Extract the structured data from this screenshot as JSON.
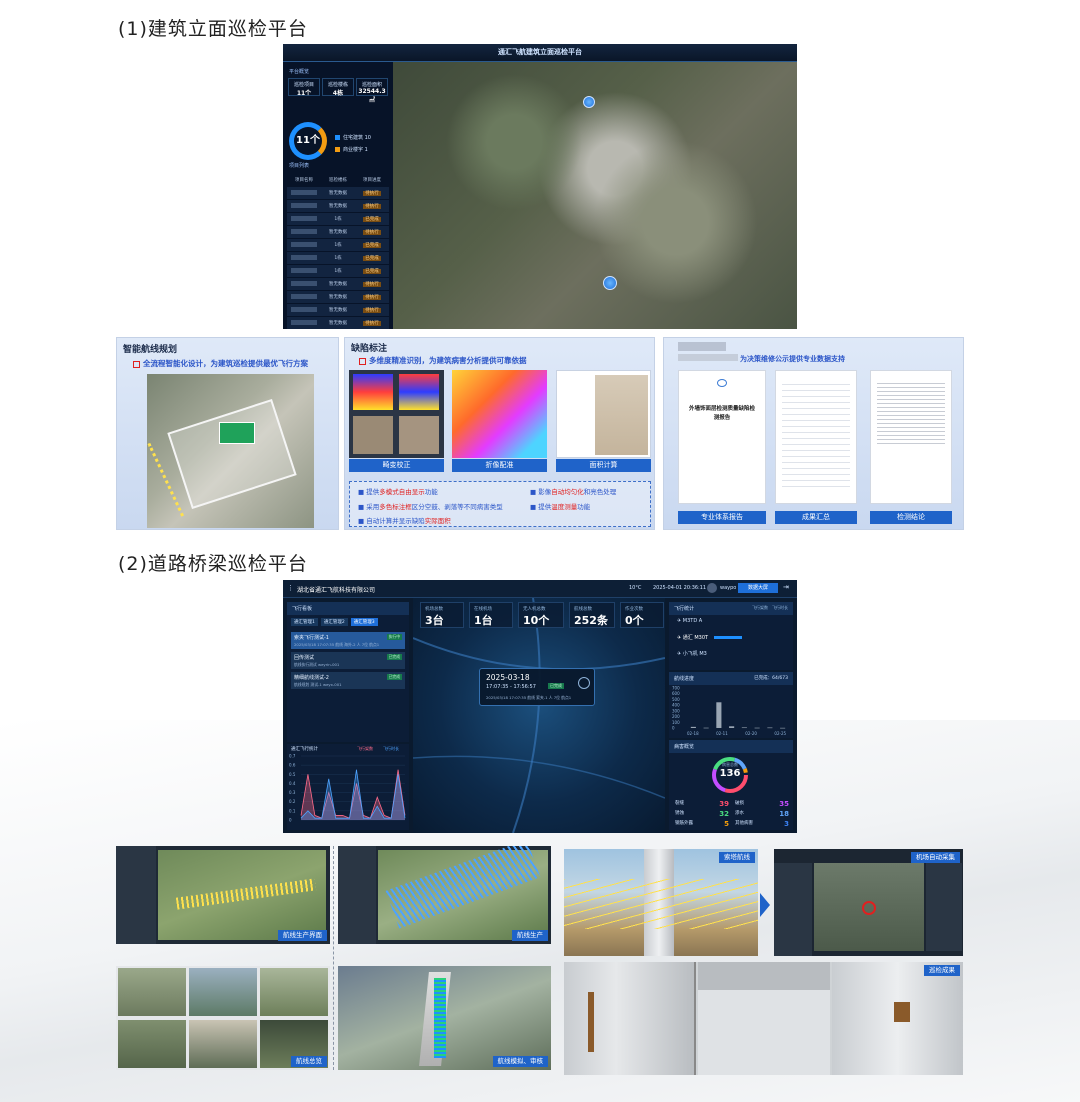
{
  "section1": {
    "title": "(1)建筑立面巡检平台"
  },
  "section2": {
    "title": "(2)道路桥梁巡检平台"
  },
  "dashboard1": {
    "title": "通汇飞航建筑立面巡检平台",
    "overview_header": "平台概览",
    "stats": [
      {
        "label": "巡检项目",
        "value": "11个"
      },
      {
        "label": "巡检楼栋",
        "value": "4栋"
      },
      {
        "label": "巡检面积",
        "value": "32544.3㎡"
      }
    ],
    "ring_value": "11个",
    "legend": [
      {
        "label": "住宅建筑",
        "value": "10",
        "color": "#1e90ff"
      },
      {
        "label": "商业楼宇",
        "value": "1",
        "color": "#f39c12"
      }
    ],
    "list_header": "项目列表",
    "list_columns": [
      "项目名称",
      "巡检楼栋",
      "项目进度"
    ],
    "list_rows": [
      {
        "count": "暂无数据",
        "tag": "待执行"
      },
      {
        "count": "暂无数据",
        "tag": "待执行"
      },
      {
        "count": "1栋",
        "tag": "已完成"
      },
      {
        "count": "暂无数据",
        "tag": "待执行"
      },
      {
        "count": "1栋",
        "tag": "已完成"
      },
      {
        "count": "1栋",
        "tag": "已完成"
      },
      {
        "count": "1栋",
        "tag": "已完成"
      },
      {
        "count": "暂无数据",
        "tag": "待执行"
      },
      {
        "count": "暂无数据",
        "tag": "待执行"
      },
      {
        "count": "暂无数据",
        "tag": "待执行"
      },
      {
        "count": "暂无数据",
        "tag": "待执行"
      }
    ]
  },
  "route_card": {
    "title": "智能航线规划",
    "subtitle": "全流程智能化设计，为建筑巡检提供最优飞行方案"
  },
  "defect_card": {
    "title": "缺陷标注",
    "subtitle": "多维度精准识别，为建筑病害分析提供可靠依据",
    "labels": [
      "畸变校正",
      "折像配准",
      "面积计算"
    ],
    "features": [
      {
        "pre": "提供",
        "hl": "多模式自由显示",
        "post": "功能"
      },
      {
        "pre": "影像",
        "hl": "自动均匀化",
        "post": "和亮色处理"
      },
      {
        "pre": "采用",
        "hl": "多色标注框",
        "post": "区分空鼓、剥落等不同病害类型"
      },
      {
        "pre": "提供",
        "hl": "温度测量",
        "post": "功能"
      },
      {
        "pre": "自动计算并显示缺陷",
        "hl": "实际面积",
        "post": ""
      }
    ]
  },
  "report_card": {
    "subtitle": "为决策维修公示提供专业数据支持",
    "doc_title": "外墙饰面层检测质量缺陷检测报告",
    "labels": [
      "专业体系报告",
      "成果汇总",
      "检测结论"
    ]
  },
  "dashboard2": {
    "company": "湖北省通汇飞航科技有限公司",
    "weather": "10°C",
    "datetime": "2025-04-01 20:36:11",
    "user": "waypo",
    "screen_button": "数据大屏",
    "flight_panel": "飞行看板",
    "tabs": [
      "通汇管理1",
      "通汇管理2",
      "通汇管理3"
    ],
    "tasks": [
      {
        "name": "索夹飞行测试-1",
        "sub": "2025/03/18 17:07:35 航线 海外-2 人 7位 航点1",
        "badge": "执行中"
      },
      {
        "name": "回传测试",
        "sub": "航线执行测试 weyrin-001",
        "badge": "已完成"
      },
      {
        "name": "精细航线测试-2",
        "sub": "航线规划 测试-1 weyx-001",
        "badge": "已完成"
      }
    ],
    "kpis": [
      {
        "label": "机场总数",
        "value": "3台"
      },
      {
        "label": "在线机场",
        "value": "1台"
      },
      {
        "label": "无人机总数",
        "value": "10个"
      },
      {
        "label": "航线总数",
        "value": "252条"
      },
      {
        "label": "作业次数",
        "value": "0个"
      }
    ],
    "popup": {
      "date": "2025-03-18",
      "time": "17:07:35 - 17:56:57",
      "sub": "2025/03/18 17:07:35 航线 索夹-1 人 7位 航点1",
      "badge": "已完成"
    },
    "right_panel": "飞行统计",
    "right_legend": [
      "飞行架数",
      "飞行时长"
    ],
    "drones": [
      {
        "name": "M3TD A"
      },
      {
        "name": "通汇 M30T"
      },
      {
        "name": "小飞机 M3"
      }
    ],
    "upload_panel": "航线进度",
    "upload_count": "已完成：64/673",
    "left_chart_title": "通汇飞行统计",
    "left_chart_legend": [
      "飞行架数",
      "飞行时长"
    ],
    "defect_panel": "病害概览",
    "defect_total_label": "病害总数",
    "defect_total": "136",
    "defect_items": [
      {
        "label": "裂缝",
        "value": "39",
        "color": "#ff4d6d"
      },
      {
        "label": "破损",
        "value": "35",
        "color": "#c44dff"
      },
      {
        "label": "锈蚀",
        "value": "32",
        "color": "#4ade80"
      },
      {
        "label": "渗水",
        "value": "18",
        "color": "#60a5fa"
      },
      {
        "label": "钢筋外露",
        "value": "5",
        "color": "#f59e0b"
      },
      {
        "label": "其他病害",
        "value": "3",
        "color": "#3b82f6"
      }
    ]
  },
  "chart_data": [
    {
      "type": "line",
      "title": "通汇飞行统计",
      "series": [
        {
          "name": "飞行架数",
          "color": "#ff6b8a",
          "values": [
            0.05,
            0.5,
            0.05,
            0.02,
            0.3,
            0.05,
            0.05,
            0.02,
            0.4,
            0.05,
            0.02,
            0.25,
            0.05,
            0.02,
            0.55,
            0.05
          ]
        },
        {
          "name": "飞行时长",
          "color": "#4da3ff",
          "values": [
            0.02,
            0.1,
            0.02,
            0.02,
            0.45,
            0.02,
            0.02,
            0.02,
            0.55,
            0.02,
            0.02,
            0.15,
            0.02,
            0.02,
            0.5,
            0.02
          ]
        }
      ],
      "ylim": [
        0,
        0.7
      ],
      "y_ticks": [
        "0",
        "0.1",
        "0.2",
        "0.3",
        "0.4",
        "0.5",
        "0.6",
        "0.7"
      ]
    },
    {
      "type": "bar",
      "title": "航线进度",
      "categories": [
        "02-18",
        "02-11",
        "02-20",
        "02-25"
      ],
      "values": [
        20,
        5,
        450,
        30,
        10,
        5,
        8,
        3
      ],
      "ylim": [
        0,
        700
      ],
      "y_ticks": [
        "0",
        "100",
        "200",
        "300",
        "400",
        "500",
        "600",
        "700"
      ]
    }
  ],
  "collage": {
    "labels": [
      "航线生产界面",
      "航线生产",
      "索塔航线",
      "机场自动采集",
      "航线总览",
      "航线模拟、审核",
      "巡检成果"
    ]
  },
  "colors": {
    "accent": "#1f63c9",
    "dark_bg": "#0a1628",
    "highlight_red": "#e02020"
  }
}
